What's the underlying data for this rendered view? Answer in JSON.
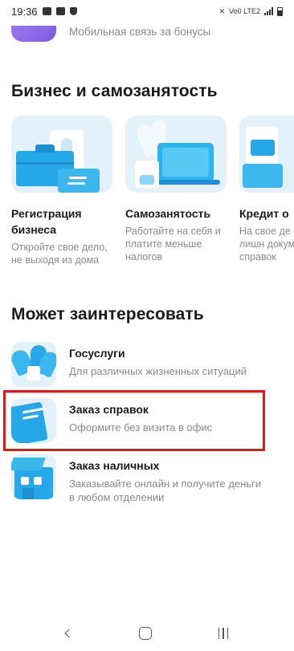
{
  "status_bar": {
    "time": "19:36",
    "net_label": "Vo0 LTE2"
  },
  "top_item": {
    "subtitle": "Мобильная связь за бонусы"
  },
  "business": {
    "title": "Бизнес и самозанятость",
    "cards": [
      {
        "title": "Регистрация бизнеса",
        "desc": "Откройте свое дело, не выходя из дома"
      },
      {
        "title": "Самозанятость",
        "desc": "Работайте на себя и платите меньше налогов"
      },
      {
        "title": "Кредит о",
        "desc": "На свое де – без лишн документо справок"
      }
    ]
  },
  "interesting": {
    "title": "Может заинтересовать",
    "items": [
      {
        "title": "Госуслуги",
        "desc": "Для различных жизненных ситуаций"
      },
      {
        "title": "Заказ справок",
        "desc": "Оформите без визита в офис"
      },
      {
        "title": "Заказ наличных",
        "desc": "Заказывайте онлайн и получите деньги в любом отделении"
      }
    ]
  },
  "colors": {
    "accent": "#26a7e8",
    "tile_bg": "#e3f1fb",
    "highlight": "#e11919",
    "purple": "#8a66e8"
  }
}
